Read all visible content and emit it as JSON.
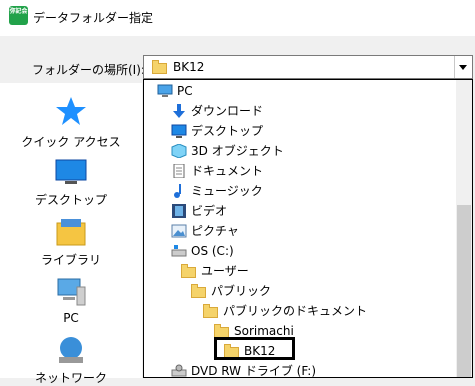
{
  "window": {
    "title": "データフォルダー指定",
    "app_badge": "弥記会"
  },
  "lookin": {
    "label": "フォルダーの場所(I):",
    "value": "BK12"
  },
  "places": [
    {
      "name": "quick-access",
      "label": "クイック アクセス"
    },
    {
      "name": "desktop",
      "label": "デスクトップ"
    },
    {
      "name": "libraries",
      "label": "ライブラリ"
    },
    {
      "name": "pc",
      "label": "PC"
    },
    {
      "name": "network",
      "label": "ネットワーク"
    }
  ],
  "dropdown": {
    "items": [
      {
        "label": "PC",
        "icon": "pc-icon"
      },
      {
        "label": "ダウンロード",
        "icon": "download-icon"
      },
      {
        "label": "デスクトップ",
        "icon": "desktop-icon"
      },
      {
        "label": "3D オブジェクト",
        "icon": "3d-objects-icon"
      },
      {
        "label": "ドキュメント",
        "icon": "documents-icon"
      },
      {
        "label": "ミュージック",
        "icon": "music-icon"
      },
      {
        "label": "ビデオ",
        "icon": "video-icon"
      },
      {
        "label": "ピクチャ",
        "icon": "pictures-icon"
      },
      {
        "label": "OS (C:)",
        "icon": "drive-icon"
      },
      {
        "label": "ユーザー",
        "icon": "folder-icon"
      },
      {
        "label": "パブリック",
        "icon": "folder-icon"
      },
      {
        "label": "パブリックのドキュメント",
        "icon": "folder-icon"
      },
      {
        "label": "Sorimachi",
        "icon": "folder-icon"
      },
      {
        "label": "BK12",
        "icon": "folder-icon"
      },
      {
        "label": "DVD RW ドライブ (F:)",
        "icon": "dvd-drive-icon"
      }
    ]
  },
  "colors": {
    "accent": "#0078d7",
    "folder": "#f5d36a",
    "app": "#22a24a"
  }
}
